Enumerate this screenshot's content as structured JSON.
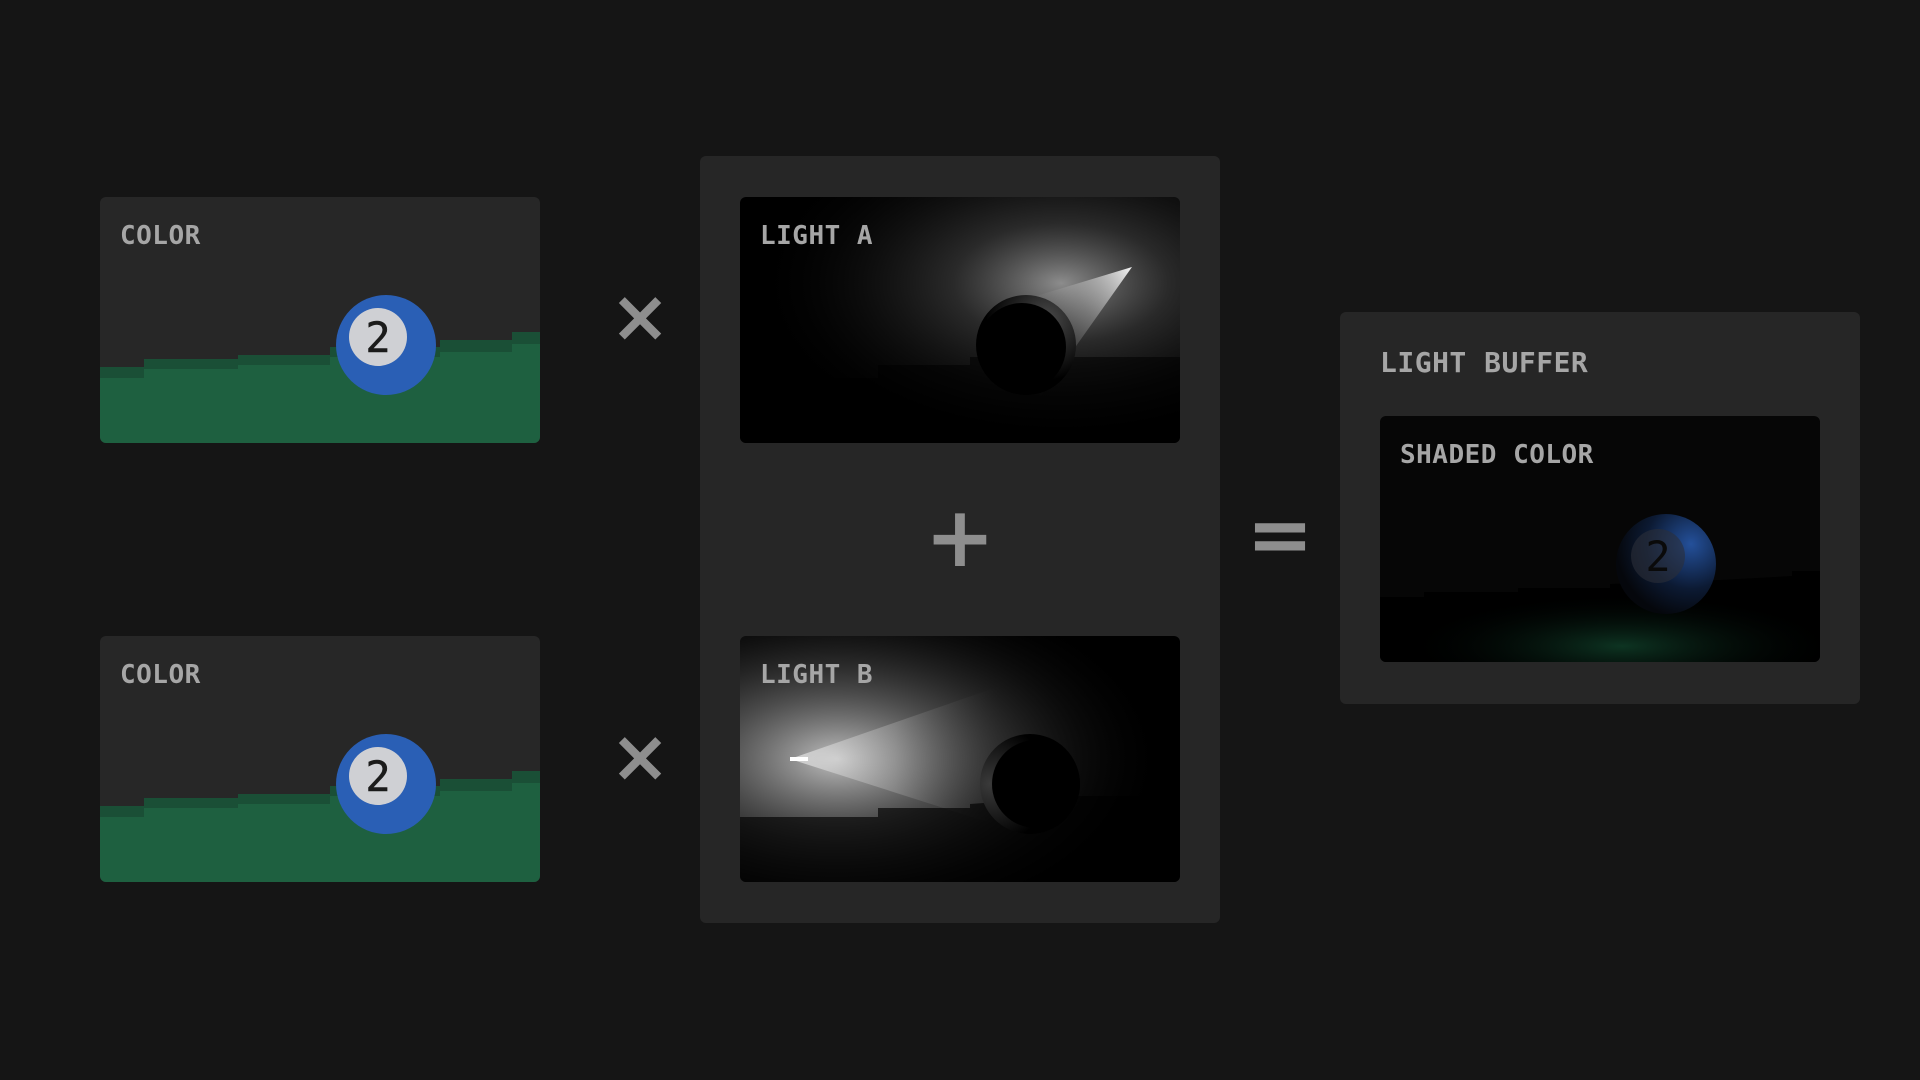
{
  "panels": {
    "color_top": {
      "label": "COLOR"
    },
    "color_bottom": {
      "label": "COLOR"
    },
    "light_a": {
      "label": "LIGHT A"
    },
    "light_b": {
      "label": "LIGHT B"
    },
    "light_buffer": {
      "label": "LIGHT BUFFER"
    },
    "shaded": {
      "label": "SHADED COLOR"
    }
  },
  "operators": {
    "multiply_top": "×",
    "multiply_bottom": "×",
    "add": "+",
    "equals": "="
  },
  "ball": {
    "number": "2"
  },
  "colors": {
    "background": "#151515",
    "panel": "#272727",
    "container": "#262626",
    "ball_blue": "#2a5fb5",
    "ball_center": "#cfd0d4",
    "ground_green": "#1e6040",
    "ground_dark": "#1a4f36",
    "label": "#a6a6a6",
    "operator": "#8e8e8e"
  }
}
